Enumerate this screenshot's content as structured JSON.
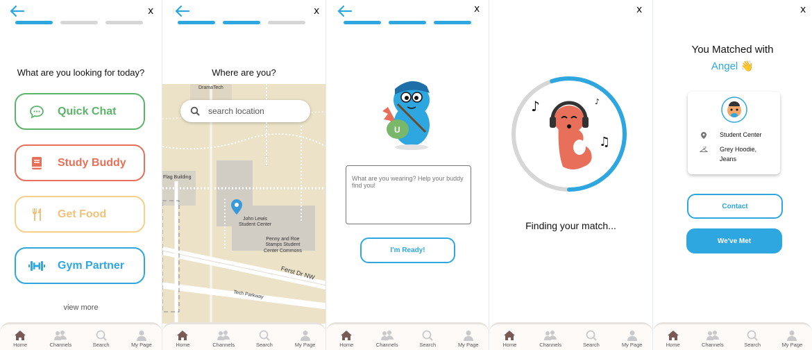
{
  "colors": {
    "accent": "#2ea7e0",
    "green": "#5cb36a",
    "red": "#e8705a",
    "yellow": "#f2c27a",
    "tabbar_bg": "#fdfaf7"
  },
  "common": {
    "close_label": "x",
    "tabs": [
      {
        "label": "Home",
        "icon": "home-icon"
      },
      {
        "label": "Channels",
        "icon": "channels-icon"
      },
      {
        "label": "Search",
        "icon": "search-icon"
      },
      {
        "label": "My Page",
        "icon": "user-icon"
      }
    ]
  },
  "screen1": {
    "progress": [
      true,
      false,
      false
    ],
    "question": "What are you looking for today?",
    "options": [
      {
        "label": "Quick Chat",
        "icon": "chat-bubble-icon"
      },
      {
        "label": "Study Buddy",
        "icon": "book-icon"
      },
      {
        "label": "Get Food",
        "icon": "fork-knife-icon"
      },
      {
        "label": "Gym Partner",
        "icon": "dumbbell-icon"
      }
    ],
    "view_more": "view more"
  },
  "screen2": {
    "progress": [
      true,
      true,
      false
    ],
    "question": "Where are you?",
    "search_placeholder": "search location",
    "map_labels": {
      "dramatech": "DramaTech",
      "flag": "Flag Building",
      "lewis": "John Lewis\nStudent Center",
      "penny": "Penny and Roe\nStamps Student\nCenter Commons",
      "ferst": "Ferst Dr NW",
      "tech": "Tech Parkway"
    }
  },
  "screen3": {
    "progress": [
      true,
      true,
      true
    ],
    "wearing_placeholder": "What are you wearing? Help your buddy find you!",
    "ready_button": "I'm Ready!"
  },
  "screen4": {
    "status": "Finding your match...",
    "progress_fraction": 0.55
  },
  "screen5": {
    "title": "You Matched with",
    "name": "Angel 👋",
    "location": "Student Center",
    "outfit": "Grey Hoodie, Jeans",
    "contact_button": "Contact",
    "met_button": "We've Met"
  }
}
